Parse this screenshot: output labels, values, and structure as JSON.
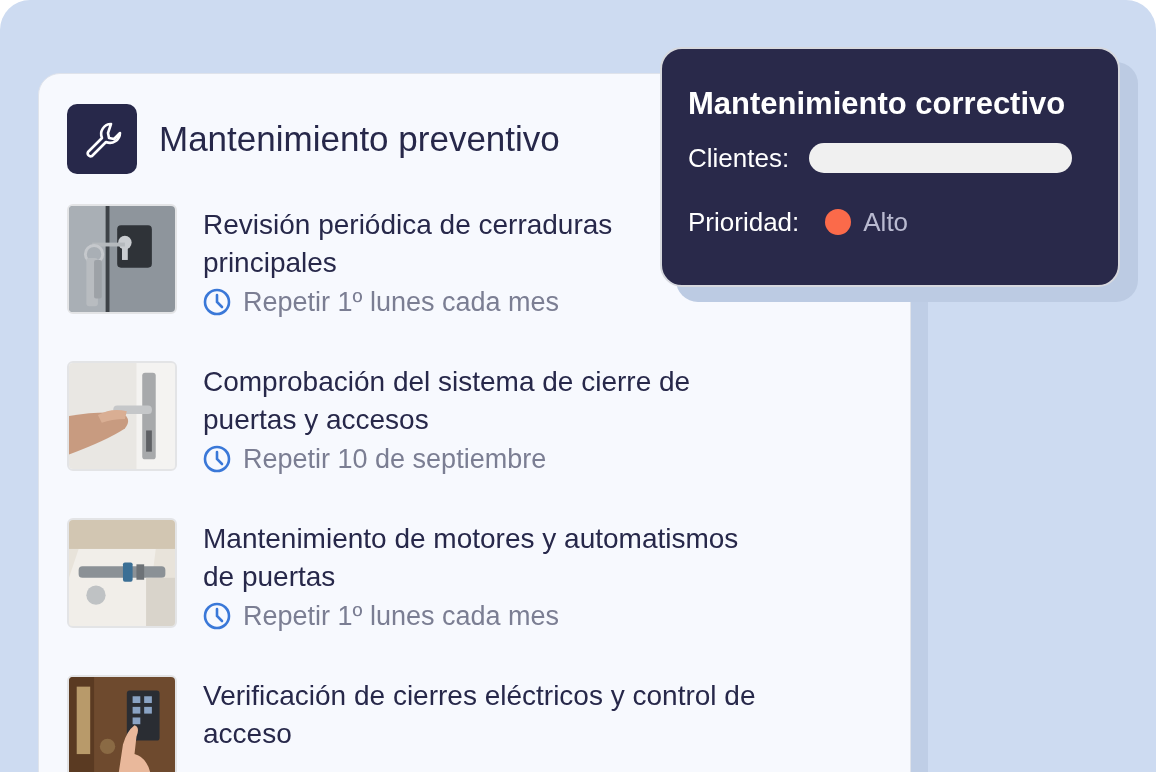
{
  "card": {
    "title": "Mantenimiento preventivo",
    "tasks": [
      {
        "title": "Revisión periódica de cerraduras\nprincipales",
        "repeat": "Repetir 1º lunes cada mes"
      },
      {
        "title": "Comprobación del sistema de cierre de\npuertas y accesos",
        "repeat": "Repetir 10 de septiembre"
      },
      {
        "title": "Mantenimiento de motores y automatismos\nde puertas",
        "repeat": "Repetir 1º lunes cada mes"
      },
      {
        "title": "Verificación de cierres eléctricos y control de\nacceso"
      }
    ]
  },
  "popup": {
    "title": "Mantenimiento correctivo",
    "fields": [
      {
        "kind": "bar",
        "label": "Clientes:"
      },
      {
        "kind": "priority",
        "label": "Prioridad:",
        "value": "Alto",
        "color": "#fb6a4a"
      }
    ]
  }
}
